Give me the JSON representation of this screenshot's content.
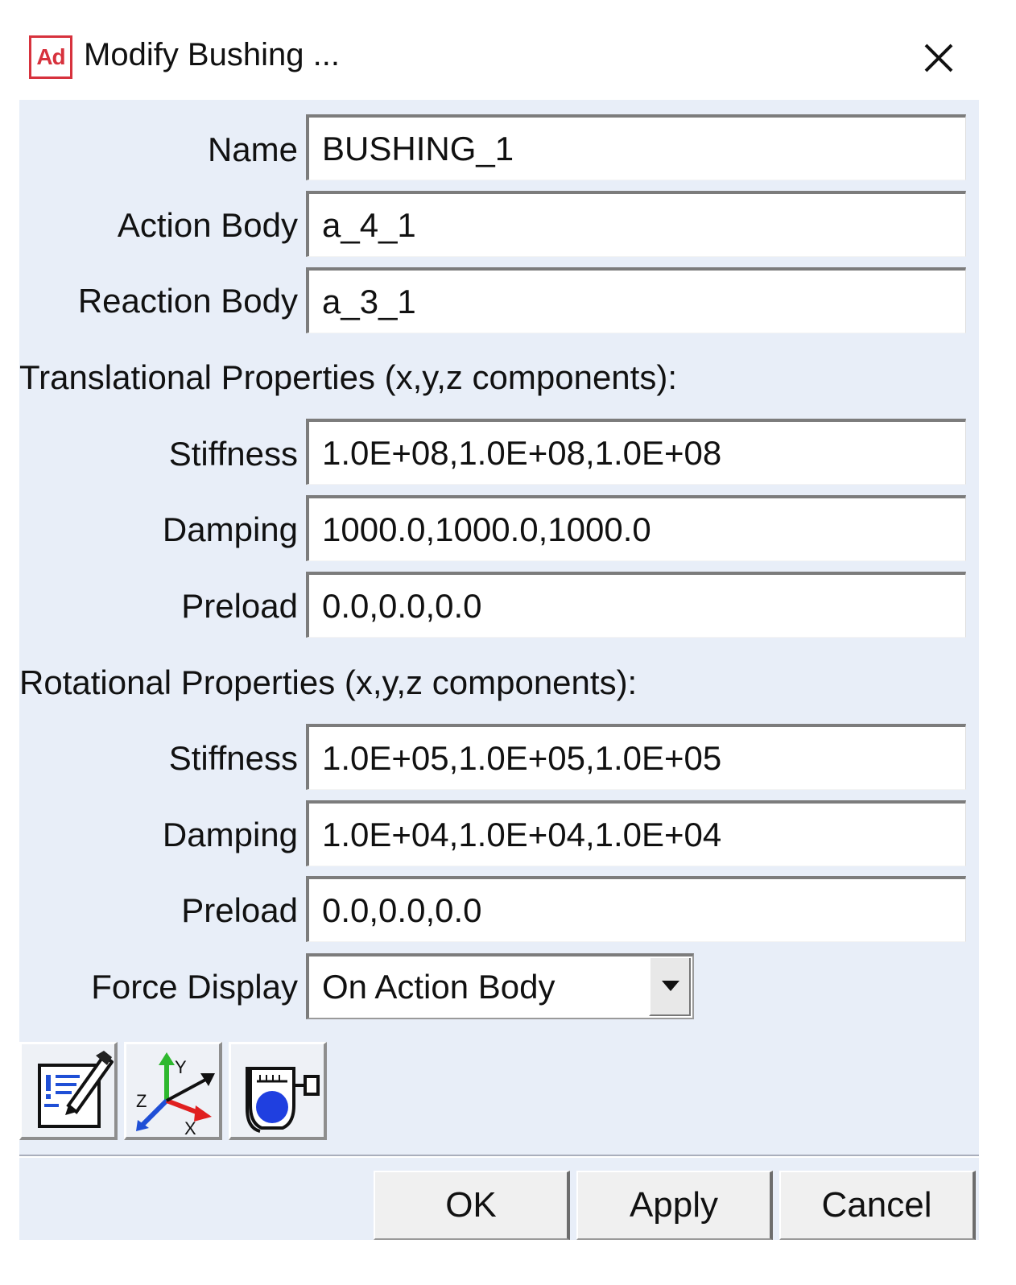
{
  "window": {
    "app_icon_text": "Ad",
    "title": "Modify Bushing ...",
    "close_icon": "close-icon",
    "accent_color": "#d7323d"
  },
  "fields": {
    "name": {
      "label": "Name",
      "value": "BUSHING_1"
    },
    "action_body": {
      "label": "Action Body",
      "value": "a_4_1"
    },
    "reaction_body": {
      "label": "Reaction Body",
      "value": "a_3_1"
    }
  },
  "translational": {
    "title": "Translational Properties (x,y,z components):",
    "stiffness": {
      "label": "Stiffness",
      "value": "1.0E+08,1.0E+08,1.0E+08"
    },
    "damping": {
      "label": "Damping",
      "value": "1000.0,1000.0,1000.0"
    },
    "preload": {
      "label": "Preload",
      "value": "0.0,0.0,0.0"
    }
  },
  "rotational": {
    "title": "Rotational Properties (x,y,z components):",
    "stiffness": {
      "label": "Stiffness",
      "value": "1.0E+05,1.0E+05,1.0E+05"
    },
    "damping": {
      "label": "Damping",
      "value": "1.0E+04,1.0E+04,1.0E+04"
    },
    "preload": {
      "label": "Preload",
      "value": "0.0,0.0,0.0"
    }
  },
  "force_display": {
    "label": "Force Display",
    "selected": "On Action Body"
  },
  "toolbar": {
    "icons": [
      "edit-notes-icon",
      "coordinate-axes-icon",
      "measure-gauge-icon"
    ],
    "axis_labels": {
      "x": "X",
      "y": "Y",
      "z": "Z"
    }
  },
  "buttons": {
    "ok": "OK",
    "apply": "Apply",
    "cancel": "Cancel"
  }
}
